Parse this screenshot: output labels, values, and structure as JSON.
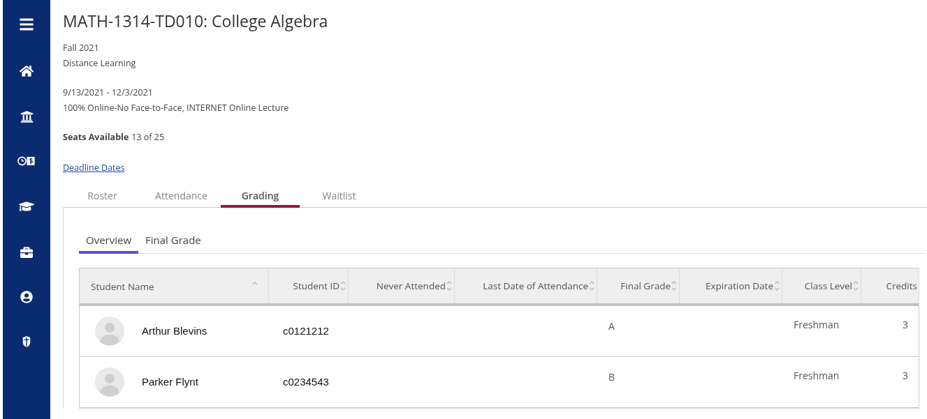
{
  "sidebar": {
    "items": [
      {
        "kind": "menu"
      },
      {
        "kind": "home"
      },
      {
        "kind": "bank"
      },
      {
        "kind": "payments"
      },
      {
        "kind": "academics"
      },
      {
        "kind": "career"
      },
      {
        "kind": "profile"
      },
      {
        "kind": "safety"
      }
    ]
  },
  "course": {
    "title": "MATH-1314-TD010: College Algebra",
    "term": "Fall 2021",
    "campus": "Distance Learning",
    "dates": "9/13/2021 - 12/3/2021",
    "method": "100% Online-No Face-to-Face, INTERNET Online Lecture",
    "seats_label": "Seats Available",
    "seats_value": "13 of 25",
    "link": "Deadline Dates"
  },
  "tabs": [
    {
      "label": "Roster",
      "selected": false
    },
    {
      "label": "Attendance",
      "selected": false
    },
    {
      "label": "Grading",
      "selected": true
    },
    {
      "label": "Waitlist",
      "selected": false
    }
  ],
  "subtabs": [
    {
      "label": "Overview",
      "selected": true
    },
    {
      "label": "Final Grade",
      "selected": false
    }
  ],
  "table": {
    "columns": [
      {
        "label": "Student Name",
        "kind": "sorted"
      },
      {
        "label": "Student ID",
        "kind": "sortable"
      },
      {
        "label": "Never Attended",
        "kind": "sortable"
      },
      {
        "label": "Last Date of Attendance",
        "kind": "sortable"
      },
      {
        "label": "Final Grade",
        "kind": "sortable"
      },
      {
        "label": "Expiration Date",
        "kind": "sortable"
      },
      {
        "label": "Class Level",
        "kind": "sortable"
      },
      {
        "label": "Credits",
        "kind": "plain"
      }
    ],
    "rows": [
      {
        "name": "Arthur Blevins",
        "id": "c0121212",
        "final_grade": "A",
        "class_level": "Freshman",
        "credits": "3"
      },
      {
        "name": "Parker Flynt",
        "id": "c0234543",
        "final_grade": "B",
        "class_level": "Freshman",
        "credits": "3"
      }
    ]
  }
}
